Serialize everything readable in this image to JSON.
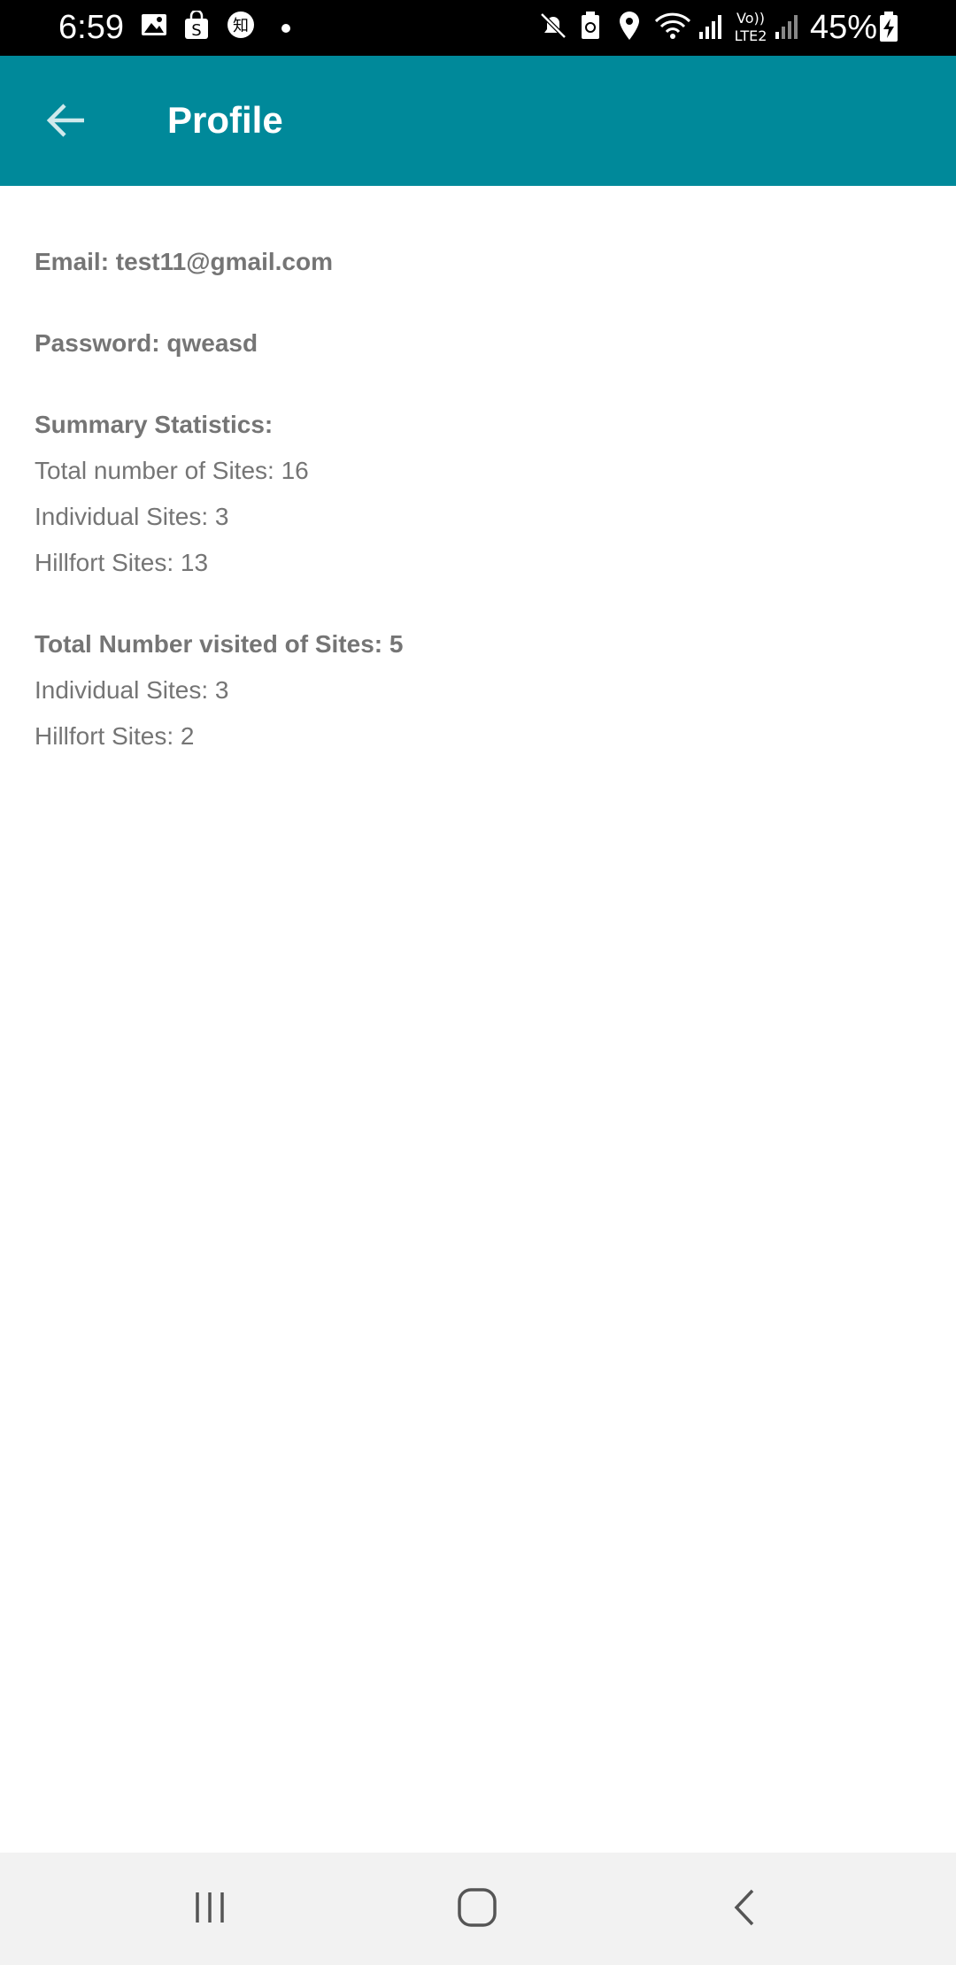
{
  "status_bar": {
    "time": "6:59",
    "battery_percent": "45%",
    "icons": [
      "image-icon",
      "shopping-bag-icon",
      "zhihu-icon",
      "dot-icon",
      "mute-icon",
      "battery-saver-icon",
      "location-icon",
      "wifi-icon",
      "signal-icon",
      "volte-lte2-icon",
      "signal-icon",
      "battery-charging-icon"
    ]
  },
  "app_bar": {
    "title": "Profile",
    "background": "#00899a"
  },
  "profile": {
    "email_line": "Email: test11@gmail.com",
    "password_line": "Password: qweasd",
    "summary_heading": "Summary Statistics:",
    "total_sites": "Total number of Sites: 16",
    "individual_sites": "Individual Sites: 3",
    "hillfort_sites": "Hillfort Sites: 13",
    "visited_heading": "Total Number visited of Sites: 5",
    "visited_individual": "Individual Sites: 3",
    "visited_hillfort": "Hillfort Sites: 2"
  },
  "nav_bar": {
    "buttons": [
      "recent-apps",
      "home",
      "back"
    ]
  }
}
